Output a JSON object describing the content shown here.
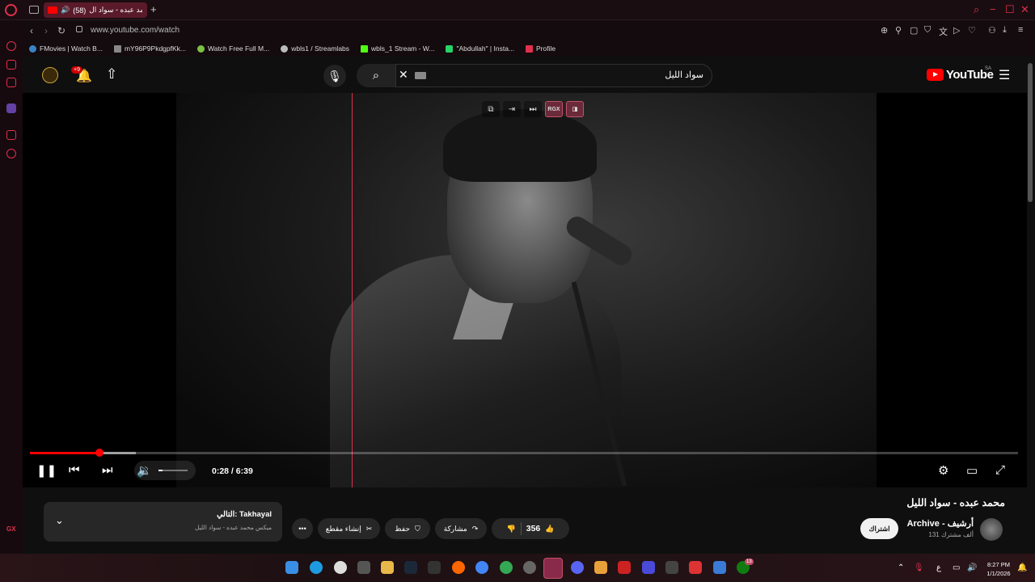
{
  "browser": {
    "tab_title": "محمد عبده - سواد ال",
    "tab_count_badge": "(58)",
    "url": "www.youtube.com/watch",
    "bookmarks": [
      {
        "label": "FMovies | Watch B...",
        "color": "#3b82c4"
      },
      {
        "label": "mY96P9PkdgpfKk...",
        "color": "#888888"
      },
      {
        "label": "Watch Free Full M...",
        "color": "#7cc242"
      },
      {
        "label": "wbls1 / Streamlabs",
        "color": "#bbbbbb"
      },
      {
        "label": "wbls_1 Stream - W...",
        "color": "#53fc18"
      },
      {
        "label": "\"Abdullah\" | Insta...",
        "color": "#25d366"
      },
      {
        "label": "Profile",
        "color": "#e0304c"
      }
    ]
  },
  "youtube": {
    "notification_badge": "+9",
    "search_query": "سواد الليل",
    "logo_text": "YouTube",
    "region": "SA"
  },
  "player": {
    "current_time": "0:28",
    "duration": "6:39",
    "time_display": "0:28 / 6:39",
    "progress_fraction": 0.07,
    "buffered_fraction": 0.107,
    "volume_fraction": 0.15,
    "overlay_tools": [
      "pip-icon",
      "exit-icon",
      "skip-icon",
      "RGX",
      "record-icon"
    ],
    "rgx_label": "RGX"
  },
  "video": {
    "title": "محمد عبده - سواد الليل",
    "channel_name": "Archive - أرشيف",
    "subscribers": "131 ألف مشترك",
    "subscribe_label": "اشتراك",
    "likes": "356",
    "share_label": "مشاركة",
    "save_label": "حفظ",
    "clip_label": "إنشاء مقطع"
  },
  "next_card": {
    "title": "التالي: Takhayal",
    "subtitle": "ميكس محمد عبده - سواد الليل"
  },
  "taskbar": {
    "time": "8:27 PM",
    "date": "1/1/2026",
    "lang": "ع",
    "xbox_badge": "13"
  }
}
